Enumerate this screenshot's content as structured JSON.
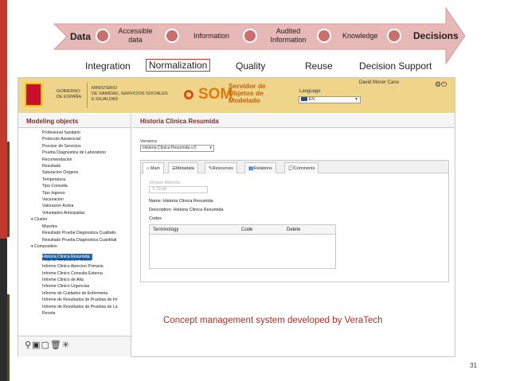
{
  "pipeline": {
    "stages": [
      {
        "label": "Data",
        "bold": true
      },
      {
        "label": "Accessible data",
        "bold": false
      },
      {
        "label": "Information",
        "bold": false
      },
      {
        "label": "Audited Information",
        "bold": false
      },
      {
        "label": "Knowledge",
        "bold": false
      },
      {
        "label": "Decisions",
        "bold": true
      }
    ],
    "accessible_line1": "Accessible",
    "accessible_line2": "data",
    "audited_line1": "Audited",
    "audited_line2": "Information",
    "steps": [
      "Integration",
      "Normalization",
      "Quality",
      "Reuse",
      "Decision Support"
    ],
    "highlighted_step": "Normalization"
  },
  "app": {
    "gov_line1": "GOBIERNO",
    "gov_line2": "DE ESPAÑA",
    "ministry_line1": "MINISTERIO",
    "ministry_line2": "DE SANIDAD, SERVICIOS SOCIALES",
    "ministry_line3": "E IGUALDAD",
    "logo": "SOM",
    "logo_sub1": "Servidor de",
    "logo_sub2": "Objetos de",
    "logo_sub3": "Modelado",
    "language_label": "Language",
    "language_value": "EN",
    "user": "David Moner Cano",
    "sidebar_title": "Modeling objects",
    "tree": [
      "Profesional Sanitario",
      "Protocolo Asistencial",
      "Provisor de Servicios",
      "Prueba Diagnostica de Laboratorio",
      "Recomendacion",
      "Resultado",
      "Saturacion Oxigeno",
      "Temperatura",
      "Tipo Consulta",
      "Tipo Ingreso",
      "Vacunacion",
      "Valoracion Activa",
      "Voluntades Anticipadas"
    ],
    "cluster_label": "Cluster",
    "cluster_items": [
      "Muestra",
      "Resultado Prueba Diagnostica Cualitativ",
      "Resultado Prueba Diagnostica Cuantitati"
    ],
    "composition_label": "Composition",
    "composition_items": [
      "Historia Clinica Resumida",
      "Hoja de Medicacion Activa",
      "Informe Clinico Atencion Primaria",
      "Informe Clinico Consulta Externa",
      "Informe Clinico de Alta",
      "Informe Clinico Urgencias",
      "Informe de Cuidados de Enfermeria",
      "Informe de Resultados de Pruebas de Im",
      "Informe de Resultados de Pruebas de La",
      "Receta"
    ],
    "selected_item": "Historia Clinica Resumida",
    "main_title": "Historia Clinica Resumida",
    "versions_label": "Versions",
    "versions_value": "Historia Clinica Resumida v.0",
    "tabs": [
      "Main",
      "Metadata",
      "Resources",
      "Relations",
      "Comments"
    ],
    "lifecycle_label": "Version lifecycle",
    "lifecycle_value": "Draft",
    "name_line": "Name: Historia Clinica Resumida",
    "desc_line": "Description: Historia Clinica Resumida",
    "codes_label": "Codes",
    "codes_columns": [
      "Terminology",
      "Code",
      "Delete"
    ]
  },
  "caption": "Concept management system developed by VeraTech",
  "page_number": "31",
  "colors": {
    "accent": "#c0392b",
    "arrow": "#e6b8b6",
    "header": "#efd58a",
    "selected": "#2b6cb0"
  }
}
